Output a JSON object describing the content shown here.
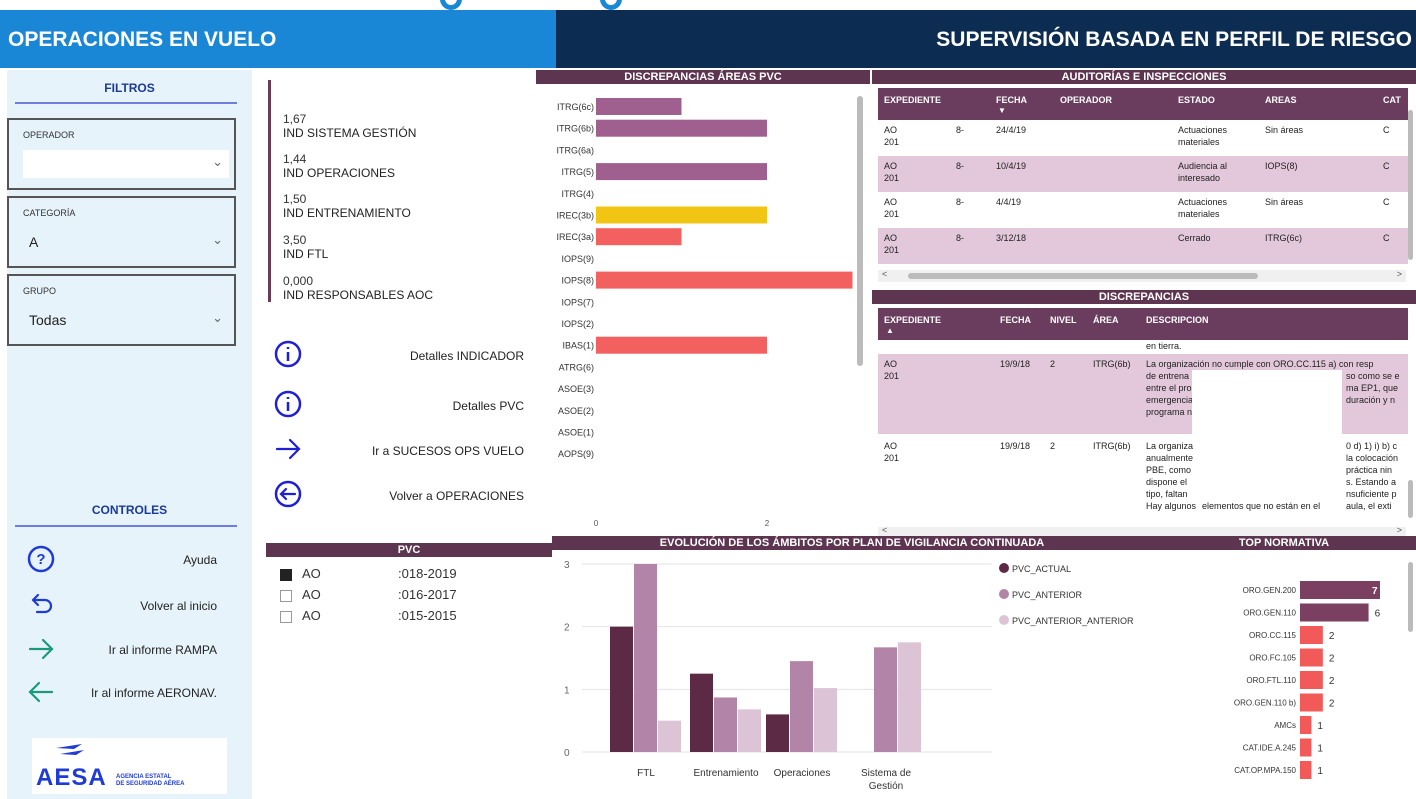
{
  "header": {
    "left_title": "OPERACIONES EN VUELO",
    "right_title": "SUPERVISIÓN BASADA EN PERFIL DE RIESGO"
  },
  "sidebar": {
    "filters_title": "FILTROS",
    "operator": {
      "label": "OPERADOR",
      "value": ""
    },
    "category": {
      "label": "CATEGORÍA",
      "value": "A"
    },
    "group": {
      "label": "GRUPO",
      "value": "Todas"
    },
    "controls_title": "CONTROLES",
    "controls": [
      {
        "label": "Ayuda",
        "icon": "help-circle-icon"
      },
      {
        "label": "Volver al inicio",
        "icon": "undo-arrow-icon"
      },
      {
        "label": "Ir al informe RAMPA",
        "icon": "arrow-right-icon"
      },
      {
        "label": "Ir al informe AERONAV.",
        "icon": "arrow-left-icon"
      }
    ],
    "logo": {
      "name": "AESA",
      "subtitle_line1": "AGENCIA ESTATAL",
      "subtitle_line2": "DE SEGURIDAD AÉREA"
    }
  },
  "indicators": [
    {
      "value": "1,67",
      "name": "IND SISTEMA GESTIÓN"
    },
    {
      "value": "1,44",
      "name": "IND OPERACIONES"
    },
    {
      "value": "1,50",
      "name": "IND ENTRENAMIENTO"
    },
    {
      "value": "3,50",
      "name": "IND FTL"
    },
    {
      "value": "0,000",
      "name": "IND RESPONSABLES AOC"
    }
  ],
  "nav_buttons": [
    {
      "label": "Detalles INDICADOR",
      "icon": "info-circle-icon"
    },
    {
      "label": "Detalles PVC",
      "icon": "info-circle-icon"
    },
    {
      "label": "Ir a SUCESOS OPS VUELO",
      "icon": "arrow-right-icon"
    },
    {
      "label": "Volver a OPERACIONES",
      "icon": "arrow-left-circle-icon"
    }
  ],
  "pvc": {
    "title": "PVC",
    "items": [
      {
        "prefix": "AO",
        "period": ":018-2019",
        "checked": true
      },
      {
        "prefix": "AO",
        "period": ":016-2017",
        "checked": false
      },
      {
        "prefix": "AO",
        "period": ":015-2015",
        "checked": false
      }
    ]
  },
  "discrepancias_areas": {
    "title": "DISCREPANCIAS ÁREAS PVC",
    "chart_data": {
      "type": "bar",
      "orientation": "horizontal",
      "categories": [
        "ITRG(6c)",
        "ITRG(6b)",
        "ITRG(6a)",
        "ITRG(5)",
        "ITRG(4)",
        "IREC(3b)",
        "IREC(3a)",
        "IOPS(9)",
        "IOPS(8)",
        "IOPS(7)",
        "IOPS(2)",
        "IBAS(1)",
        "ATRG(6)",
        "ASOE(3)",
        "ASOE(2)",
        "ASOE(1)",
        "AOPS(9)"
      ],
      "values": [
        1,
        2,
        0,
        2,
        0,
        2,
        1,
        0,
        3,
        0,
        0,
        2,
        0,
        0,
        0,
        0,
        0
      ],
      "colors": [
        "#a0608f",
        "#a0608f",
        "#a0608f",
        "#a0608f",
        "#a0608f",
        "#f2c514",
        "#f26060",
        "#f26060",
        "#f26060",
        "#f26060",
        "#f26060",
        "#f26060",
        "#f26060",
        "#f26060",
        "#f26060",
        "#f26060",
        "#f26060"
      ],
      "xticks": [
        "0",
        "2"
      ],
      "xlim": [
        0,
        3
      ]
    }
  },
  "auditorias": {
    "title": "AUDITORÍAS E INSPECCIONES",
    "columns": [
      "EXPEDIENTE",
      "FECHA",
      "OPERADOR",
      "ESTADO",
      "AREAS",
      "CAT"
    ],
    "rows": [
      {
        "exp": "AO\n201",
        "exp2": "8-",
        "fecha": "24/4/19",
        "operador": "",
        "estado": "Actuaciones\nmateriales",
        "areas": "Sin áreas",
        "cat": "C",
        "highlight": false
      },
      {
        "exp": "AO\n201",
        "exp2": "8-",
        "fecha": "10/4/19",
        "operador": "",
        "estado": "Audiencia al\ninteresado",
        "areas": "IOPS(8)",
        "cat": "C",
        "highlight": true
      },
      {
        "exp": "AO\n201",
        "exp2": "8-",
        "fecha": "4/4/19",
        "operador": "",
        "estado": "Actuaciones\nmateriales",
        "areas": "Sin áreas",
        "cat": "C",
        "highlight": false
      },
      {
        "exp": "AO\n201",
        "exp2": "8-",
        "fecha": "3/12/18",
        "operador": "",
        "estado": "Cerrado",
        "areas": "ITRG(6c)",
        "cat": "C",
        "highlight": true
      }
    ]
  },
  "discrepancias": {
    "title": "DISCREPANCIAS",
    "columns": [
      "EXPEDIENTE",
      "FECHA",
      "NIVEL",
      "ÁREA",
      "DESCRIPCION"
    ],
    "top_fragment": "en tierra.",
    "rows": [
      {
        "exp": "AO\n201",
        "fecha": "19/9/18",
        "nivel": "2",
        "area": "ITRG(6b)",
        "desc_left": "La organización no cumple con ORO.CC.115 a) con resp\nde entrena\nentre el pro\nemergencia\nprograma n",
        "desc_right": "\nso como se e\nma EP1, que\nduración y n\n",
        "highlight": true
      },
      {
        "exp": "AO\n201",
        "fecha": "19/9/18",
        "nivel": "2",
        "area": "ITRG(6b)",
        "desc_left": "La organiza\nanualmente\nPBE, como\ndispone el\ntipo, faltan\nHay algunos",
        "desc_right": "0 d) 1) i) b) c\nla colocación\npráctica nin\ns. Estando a\nnsuficiente p\naula, el exti",
        "desc_mid_bottom": "elementos que no están en el",
        "highlight": false
      }
    ]
  },
  "evolucion": {
    "title": "EVOLUCIÓN DE LOS ÁMBITOS POR PLAN DE VIGILANCIA CONTINUADA",
    "chart_data": {
      "type": "bar",
      "categories": [
        "FTL",
        "Entrenamiento",
        "Operaciones",
        "Sistema de\nGestión"
      ],
      "series": [
        {
          "name": "PVC_ACTUAL",
          "color": "#5c2a45",
          "values": [
            2.0,
            1.25,
            0.6,
            0
          ]
        },
        {
          "name": "PVC_ANTERIOR",
          "color": "#b184a8",
          "values": [
            3.0,
            0.87,
            1.45,
            1.67
          ]
        },
        {
          "name": "PVC_ANTERIOR_ANTERIOR",
          "color": "#dcc3d6",
          "values": [
            0.5,
            0.68,
            1.02,
            1.75
          ]
        }
      ],
      "ylim": [
        0,
        3
      ],
      "yticks": [
        "0",
        "1",
        "2",
        "3"
      ]
    }
  },
  "top_normativa": {
    "title": "TOP NORMATIVA",
    "chart_data": {
      "type": "bar",
      "orientation": "horizontal",
      "categories": [
        "ORO.GEN.200",
        "ORO.GEN.110",
        "ORO.CC.115",
        "ORO.FC.105",
        "ORO.FTL.110",
        "ORO.GEN.110 b)",
        "AMCs",
        "CAT.IDE.A.245",
        "CAT.OP.MPA.150"
      ],
      "values": [
        7,
        6,
        2,
        2,
        2,
        2,
        1,
        1,
        1
      ],
      "value_labels": [
        "7",
        "6",
        "2",
        "2",
        "2",
        "2",
        "1",
        "1",
        "1"
      ],
      "colors": [
        "#7b3f62",
        "#7b3f62",
        "#f25a5a",
        "#f25a5a",
        "#f25a5a",
        "#f25a5a",
        "#f25a5a",
        "#f25a5a",
        "#f25a5a"
      ],
      "xlim": [
        0,
        7
      ]
    }
  }
}
